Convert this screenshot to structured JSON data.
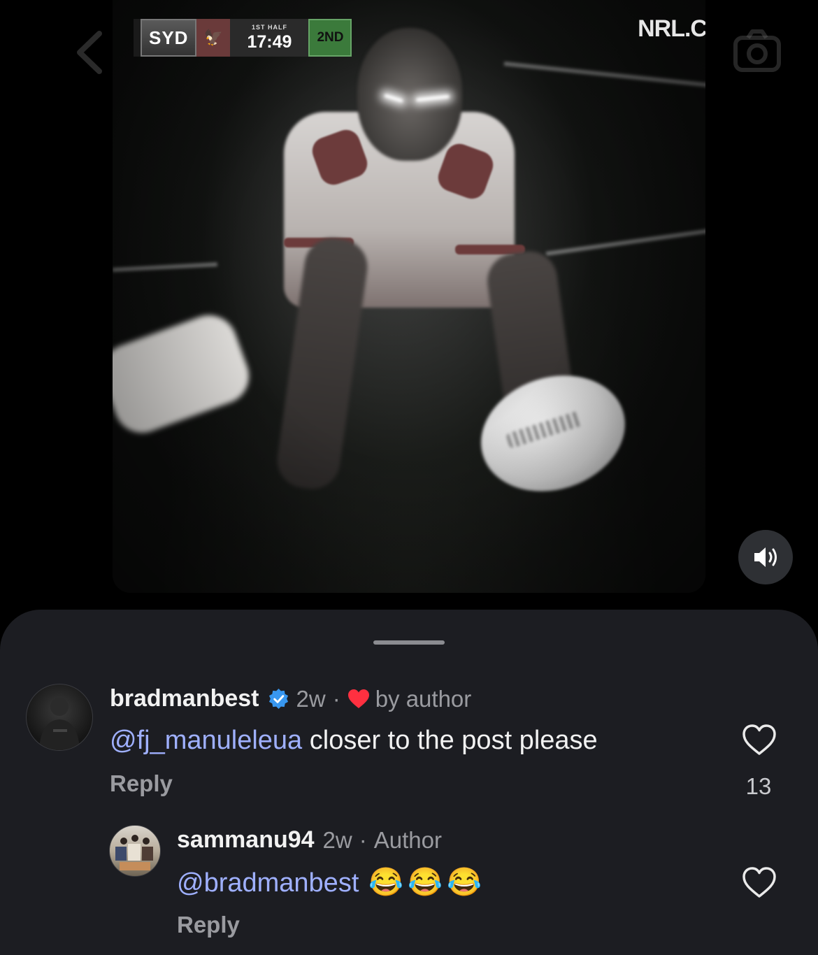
{
  "video": {
    "scorebug": {
      "team": "SYD",
      "half": "1ST HALF",
      "clock": "17:49",
      "down": "2ND"
    },
    "watermark": "NRL.C"
  },
  "comments": [
    {
      "username": "bradmanbest",
      "verified": true,
      "age": "2w",
      "liked_by_author_label": "by author",
      "mention": "@fj_manuleleua",
      "text": " closer to the post please",
      "reply_label": "Reply",
      "like_count": "13"
    },
    {
      "username": "sammanu94",
      "age": "2w",
      "role": "Author",
      "mention": "@bradmanbest",
      "emojis": "😂😂😂",
      "reply_label": "Reply"
    }
  ],
  "colors": {
    "sheet_bg": "#1c1d22",
    "mention": "#9fb0ff",
    "verified": "#3897f0",
    "heart": "#ff3040"
  }
}
